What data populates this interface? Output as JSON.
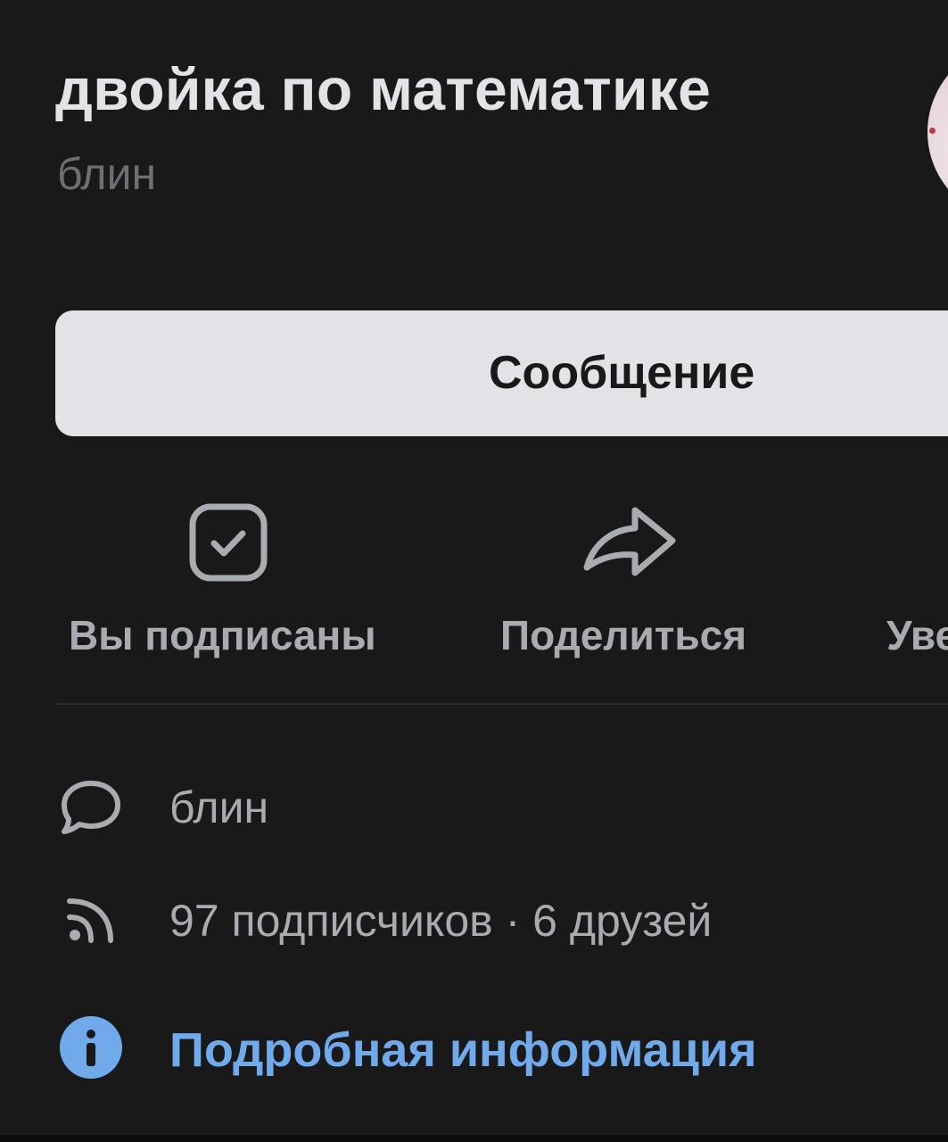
{
  "profile": {
    "name": "двойка по математике",
    "status": "блин"
  },
  "buttons": {
    "message_label": "Сообщение"
  },
  "actions": [
    {
      "label": "Вы подписаны",
      "icon": "checkbox-checked-icon"
    },
    {
      "label": "Поделиться",
      "icon": "share-arrow-icon"
    },
    {
      "label": "Уве",
      "icon": "bell-icon"
    }
  ],
  "info": {
    "status_text": "блин",
    "status_icon": "speech-bubble-icon",
    "followers_text": "97 подписчиков · 6 друзей",
    "followers_icon": "rss-feed-icon",
    "details_link": "Подробная информация",
    "details_icon": "info-circle-icon"
  },
  "colors": {
    "background": "#19191a",
    "primary_text": "#e1e3e6",
    "secondary_text": "#a8abb0",
    "muted_text": "#6d6f73",
    "accent": "#71aaeb",
    "button_bg": "#e1e3e6"
  }
}
